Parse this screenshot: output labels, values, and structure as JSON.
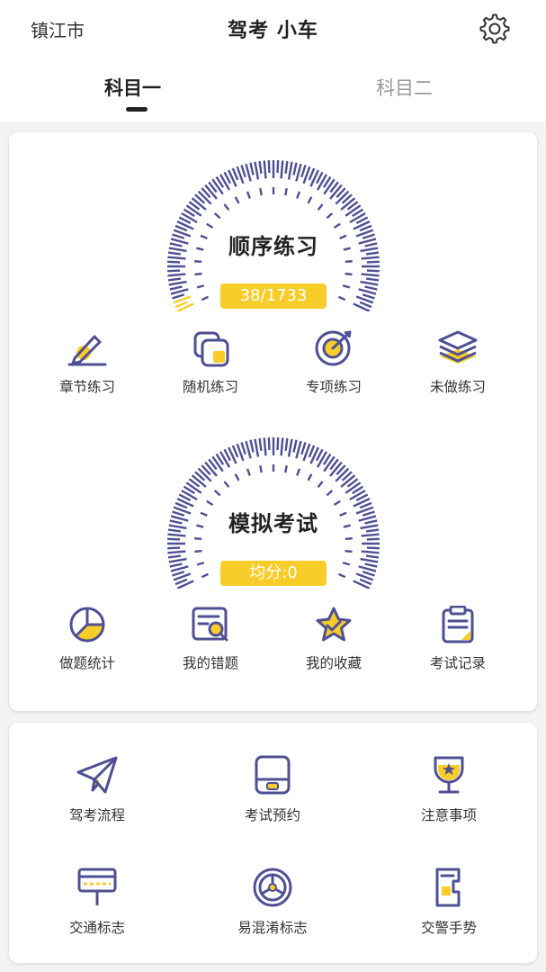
{
  "header": {
    "city": "镇江市",
    "title": "驾考 小车",
    "settings_icon": "gear-icon"
  },
  "tabs": [
    {
      "label": "科目一",
      "active": true
    },
    {
      "label": "科目二",
      "active": false
    }
  ],
  "practice": {
    "gauge_title": "顺序练习",
    "progress_text": "38/1733",
    "done": 38,
    "total": 1733,
    "items": [
      {
        "label": "章节练习",
        "icon": "pencil-edit-icon"
      },
      {
        "label": "随机练习",
        "icon": "random-cards-icon"
      },
      {
        "label": "专项练习",
        "icon": "target-icon"
      },
      {
        "label": "未做练习",
        "icon": "layers-icon"
      }
    ]
  },
  "exam": {
    "gauge_title": "模拟考试",
    "score_text": "均分:0",
    "items": [
      {
        "label": "做题统计",
        "icon": "pie-chart-icon"
      },
      {
        "label": "我的错题",
        "icon": "wrong-questions-icon"
      },
      {
        "label": "我的收藏",
        "icon": "star-icon"
      },
      {
        "label": "考试记录",
        "icon": "clipboard-icon"
      }
    ]
  },
  "tools": [
    {
      "label": "驾考流程",
      "icon": "paper-plane-icon"
    },
    {
      "label": "考试预约",
      "icon": "booking-device-icon"
    },
    {
      "label": "注意事项",
      "icon": "trophy-icon"
    },
    {
      "label": "交通标志",
      "icon": "road-sign-icon"
    },
    {
      "label": "易混淆标志",
      "icon": "wheel-icon"
    },
    {
      "label": "交警手势",
      "icon": "police-badge-icon"
    }
  ],
  "colors": {
    "accent_yellow": "#f8cd2a",
    "primary_indigo": "#4f4f93",
    "background": "#f3f3f5"
  }
}
